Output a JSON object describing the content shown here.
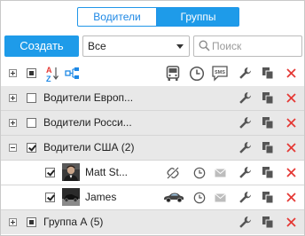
{
  "tabs": [
    {
      "label": "Водители",
      "active": false
    },
    {
      "label": "Группы",
      "active": true
    }
  ],
  "toolbar": {
    "create_label": "Создать",
    "filter_selected": "Все",
    "search_placeholder": "Поиск"
  },
  "colors": {
    "accent": "#1e9be9",
    "delete": "#e53935",
    "group_row_bg": "#e8e8e8"
  },
  "header_icons": [
    "expand-all-icon",
    "select-all-icon",
    "sort-az-icon",
    "hierarchy-icon",
    "vehicle-icon",
    "clock-icon",
    "sms-icon",
    "wrench-icon",
    "copy-icon",
    "delete-icon"
  ],
  "rows": [
    {
      "type": "group",
      "label": "Водители Европ...",
      "expanded": false,
      "checkbox": "unchecked"
    },
    {
      "type": "group",
      "label": "Водители Росси...",
      "expanded": false,
      "checkbox": "unchecked"
    },
    {
      "type": "group",
      "label": "Водители США (2)",
      "expanded": true,
      "checkbox": "checked"
    },
    {
      "type": "driver",
      "label": "Matt St...",
      "checkbox": "checked",
      "binding": "unlinked-icon"
    },
    {
      "type": "driver",
      "label": "James",
      "checkbox": "checked",
      "binding": "car-icon"
    },
    {
      "type": "group",
      "label": "Группа А (5)",
      "expanded": false,
      "checkbox": "partial"
    }
  ]
}
